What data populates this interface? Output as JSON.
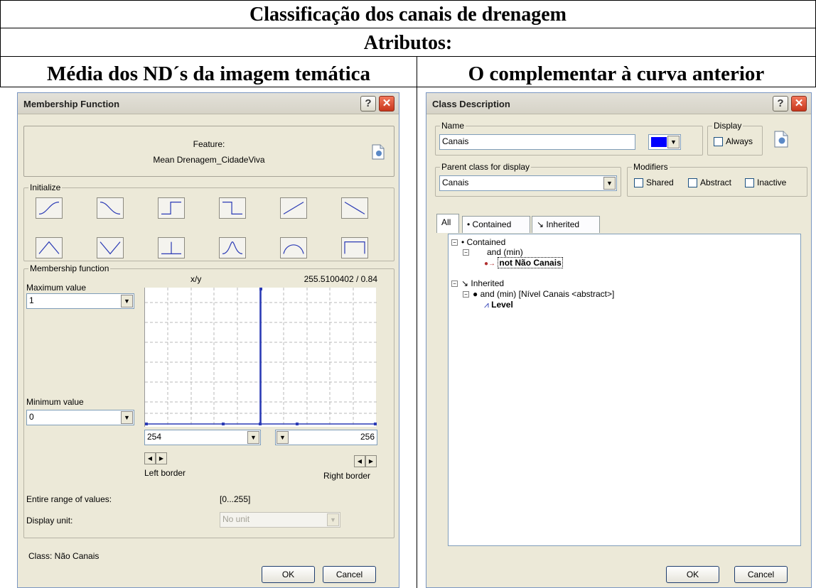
{
  "table": {
    "title": "Classificação dos canais de drenagem",
    "subtitle": "Atributos:",
    "col_left": "Média dos ND´s da imagem temática",
    "col_right": "O complementar à curva anterior"
  },
  "membership_dialog": {
    "title": "Membership Function",
    "feature_label": "Feature:",
    "feature_value": "Mean Drenagem_CidadeViva",
    "initialize_label": "Initialize",
    "mf_label": "Membership function",
    "xy_label": "x/y",
    "xy_value": "255.5100402 / 0.84",
    "max_label": "Maximum value",
    "max_value": "1",
    "min_label": "Minimum value",
    "min_value": "0",
    "left_value": "254",
    "right_value": "256",
    "left_border_label": "Left border",
    "right_border_label": "Right border",
    "range_label": "Entire range of values:",
    "range_value": "[0...255]",
    "unit_label": "Display unit:",
    "unit_value": "No unit",
    "class_label": "Class: Não Canais",
    "ok_label": "OK",
    "cancel_label": "Cancel",
    "help_glyph": "?",
    "close_glyph": "✕"
  },
  "class_dialog": {
    "title": "Class Description",
    "name_group": "Name",
    "name_value": "Canais",
    "color_value": "#0000ff",
    "display_group": "Display",
    "always_label": "Always",
    "parent_group": "Parent class for display",
    "parent_value": "Canais",
    "modifiers_group": "Modifiers",
    "shared_label": "Shared",
    "abstract_label": "Abstract",
    "inactive_label": "Inactive",
    "tabs": [
      "All",
      "Contained",
      "Inherited"
    ],
    "tree": {
      "contained": "Contained",
      "and_min": "and (min)",
      "not_nao_canais": "not Não Canais",
      "inherited": "Inherited",
      "and_min_abstract": "and (min) [Nível Canais <abstract>]",
      "level": "Level"
    },
    "ok_label": "OK",
    "cancel_label": "Cancel",
    "help_glyph": "?",
    "close_glyph": "✕"
  }
}
